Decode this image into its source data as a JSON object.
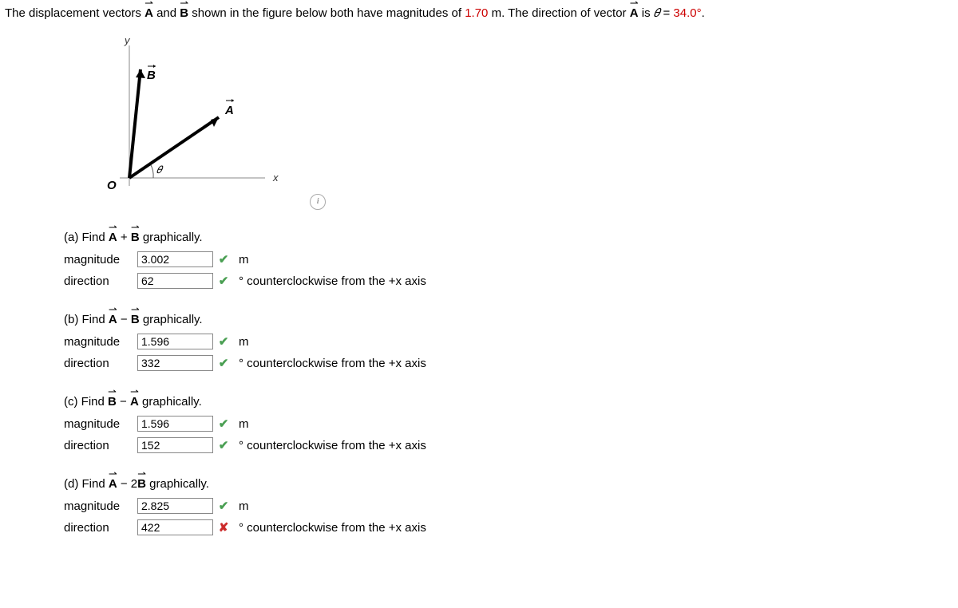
{
  "intro": {
    "t1": "The displacement vectors ",
    "t2": " and ",
    "t3": " shown in the figure below both have magnitudes of ",
    "magnitude": "1.70",
    "t4": " m. The direction of vector ",
    "t5": " is ",
    "theta_eq": " = ",
    "angle": "34.0°",
    "period": "."
  },
  "labels": {
    "A": "A",
    "B": "B",
    "theta": "𝜃",
    "O": "O",
    "x": "x",
    "y": "y"
  },
  "parts": {
    "a": {
      "title_pre": "(a) Find ",
      "op": " + ",
      "title_post": " graphically.",
      "mag_label": "magnitude",
      "dir_label": "direction",
      "mag_val": "3.002",
      "dir_val": "62",
      "mag_mark": "✔",
      "dir_mark": "✔",
      "mag_unit": "m",
      "dir_unit": "° counterclockwise from the +x axis",
      "mag_correct": true,
      "dir_correct": true
    },
    "b": {
      "title_pre": "(b) Find ",
      "op": " − ",
      "title_post": " graphically.",
      "mag_label": "magnitude",
      "dir_label": "direction",
      "mag_val": "1.596",
      "dir_val": "332",
      "mag_mark": "✔",
      "dir_mark": "✔",
      "mag_unit": "m",
      "dir_unit": "° counterclockwise from the +x axis",
      "mag_correct": true,
      "dir_correct": true
    },
    "c": {
      "title_pre": "(c) Find ",
      "op": " − ",
      "title_post": " graphically.",
      "mag_label": "magnitude",
      "dir_label": "direction",
      "mag_val": "1.596",
      "dir_val": "152",
      "mag_mark": "✔",
      "dir_mark": "✔",
      "mag_unit": "m",
      "dir_unit": "° counterclockwise from the +x axis",
      "mag_correct": true,
      "dir_correct": true
    },
    "d": {
      "title_pre": "(d) Find ",
      "op": " − 2",
      "title_post": " graphically.",
      "mag_label": "magnitude",
      "dir_label": "direction",
      "mag_val": "2.825",
      "dir_val": "422",
      "mag_mark": "✔",
      "dir_mark": "✘",
      "mag_unit": "m",
      "dir_unit": "° counterclockwise from the +x axis",
      "mag_correct": true,
      "dir_correct": false
    }
  },
  "chart_data": {
    "type": "vector_diagram",
    "vectors": [
      {
        "name": "A",
        "magnitude": 1.7,
        "angle_deg": 34.0
      },
      {
        "name": "B",
        "magnitude": 1.7,
        "angle_deg": 90.0
      }
    ],
    "origin_label": "O",
    "axes": {
      "x": "x",
      "y": "y"
    },
    "angle_label": "𝜃"
  }
}
